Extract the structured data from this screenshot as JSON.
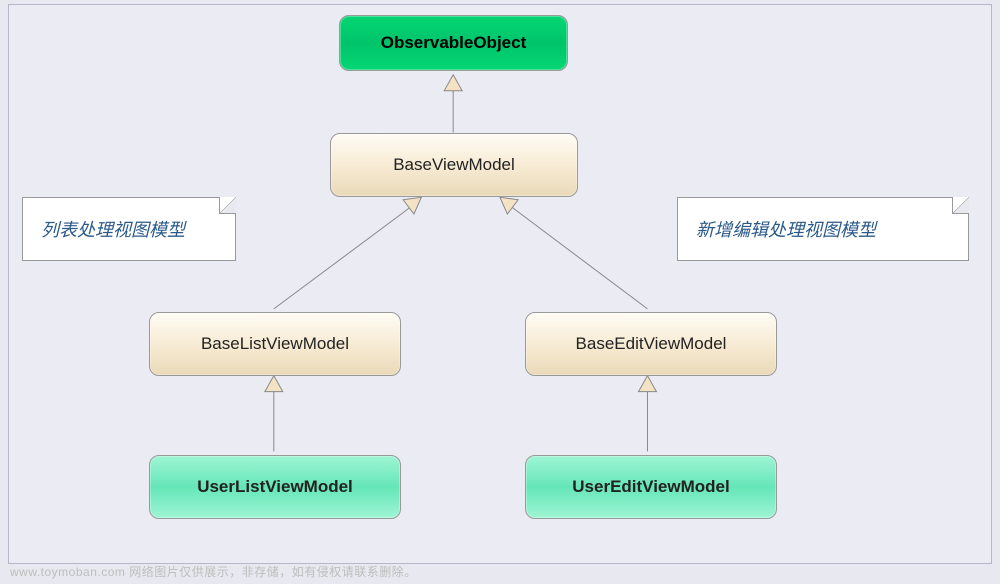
{
  "diagram": {
    "nodes": {
      "root": "ObservableObject",
      "base": "BaseViewModel",
      "baseList": "BaseListViewModel",
      "baseEdit": "BaseEditViewModel",
      "userList": "UserListViewModel",
      "userEdit": "UserEditViewModel"
    },
    "notes": {
      "listNote": "列表处理视图模型",
      "editNote": "新增编辑处理视图模型"
    },
    "edges": [
      {
        "from": "base",
        "to": "root",
        "kind": "inherit"
      },
      {
        "from": "baseList",
        "to": "base",
        "kind": "inherit"
      },
      {
        "from": "baseEdit",
        "to": "base",
        "kind": "inherit"
      },
      {
        "from": "userList",
        "to": "baseList",
        "kind": "inherit"
      },
      {
        "from": "userEdit",
        "to": "baseEdit",
        "kind": "inherit"
      }
    ]
  },
  "footer": "www.toymoban.com  网络图片仅供展示，非存储，如有侵权请联系删除。"
}
